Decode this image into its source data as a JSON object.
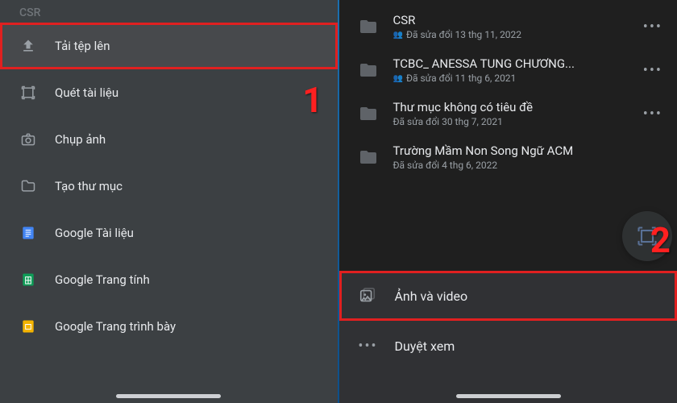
{
  "left": {
    "header": "CSR",
    "actions": [
      {
        "label": "Tải tệp lên",
        "icon": "upload-icon",
        "hl": true
      },
      {
        "label": "Quét tài liệu",
        "icon": "scan-icon"
      },
      {
        "label": "Chụp ảnh",
        "icon": "camera-icon"
      },
      {
        "label": "Tạo thư mục",
        "icon": "folder-new-icon"
      },
      {
        "label": "Google Tài liệu",
        "icon": "google-docs-icon"
      },
      {
        "label": "Google Trang tính",
        "icon": "google-sheets-icon"
      },
      {
        "label": "Google Trang trình bày",
        "icon": "google-slides-icon"
      }
    ]
  },
  "right": {
    "folders": [
      {
        "name": "CSR",
        "meta": "Đã sửa đổi 13 thg 11, 2022",
        "shared": true
      },
      {
        "name": "TCBC_ ANESSA TUNG CHƯƠNG...",
        "meta": "Đã sửa đổi 11 thg 6, 2021",
        "shared": true
      },
      {
        "name": "Thư mục không có tiêu đề",
        "meta": "Đã sửa đổi 30 thg 7, 2021",
        "shared": false
      },
      {
        "name": "Trường Mầm Non Song Ngữ ACM",
        "meta": "Đã sửa đổi 4 thg 6, 2022",
        "shared": false
      }
    ],
    "sheet": [
      {
        "label": "Ảnh và video",
        "icon": "media-icon",
        "hl": true
      },
      {
        "label": "Duyệt xem",
        "icon": "more-icon"
      }
    ]
  },
  "callouts": {
    "one": "1",
    "two": "2"
  }
}
